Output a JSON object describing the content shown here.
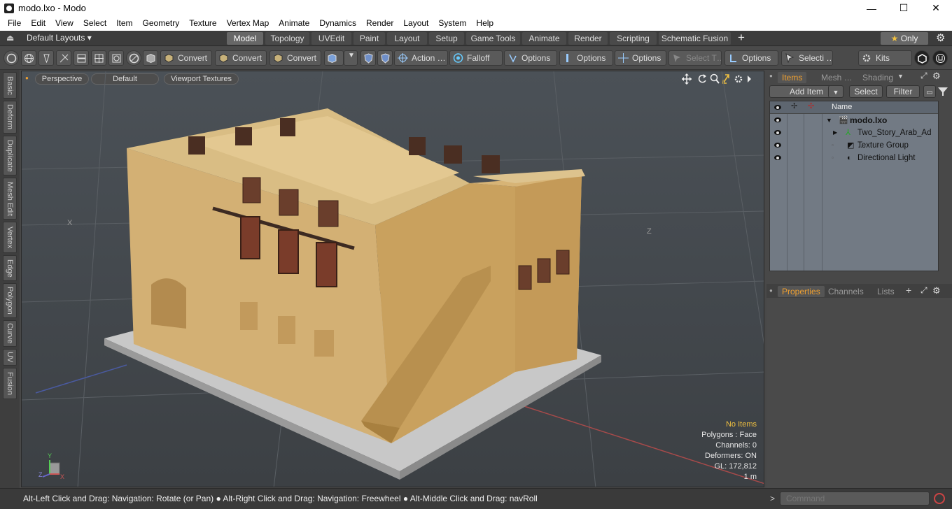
{
  "window": {
    "title": "modo.lxo - Modo",
    "minimize": "—",
    "maximize": "☐",
    "close": "✕"
  },
  "menubar": [
    "File",
    "Edit",
    "View",
    "Select",
    "Item",
    "Geometry",
    "Texture",
    "Vertex Map",
    "Animate",
    "Dynamics",
    "Render",
    "Layout",
    "System",
    "Help"
  ],
  "layoutbar": {
    "layout_selector": "Default Layouts ▾",
    "tabs": [
      "Model",
      "Topology",
      "UVEdit",
      "Paint",
      "Layout",
      "Setup",
      "Game Tools",
      "Animate",
      "Render",
      "Scripting",
      "Schematic Fusion"
    ],
    "active_tab": "Model",
    "add": "+",
    "only": "★  Only",
    "gear": "⚙"
  },
  "toolbar": {
    "convert1": "Convert",
    "convert2": "Convert",
    "convert3": "Convert",
    "action": "Action  …",
    "falloff": "Falloff",
    "options1": "Options",
    "options2": "Options",
    "options3": "Options",
    "select_t": "Select T…",
    "options4": "Options",
    "selecti": "Selecti …",
    "kits": "Kits"
  },
  "lefttabs": [
    "Basic",
    "Deform",
    "Duplicate",
    "Mesh Edit",
    "Vertex",
    "Edge",
    "Polygon",
    "Curve",
    "UV",
    "Fusion"
  ],
  "viewport": {
    "perspective": "Perspective",
    "default": "Default",
    "textures": "Viewport Textures",
    "info": {
      "no_items": "No Items",
      "polygons": "Polygons : Face",
      "channels": "Channels: 0",
      "deformers": "Deformers: ON",
      "gl": "GL: 172,812",
      "scale": "1 m"
    },
    "axis_x": "X",
    "axis_z": "Z",
    "axis_y": "Y"
  },
  "rightpanel": {
    "tabs": [
      "Items",
      "Mesh …",
      "Shading"
    ],
    "add_item": "Add Item",
    "select": "Select",
    "filter": "Filter",
    "name_header": "Name",
    "items": [
      "modo.lxo",
      "Two_Story_Arab_Ad …",
      "Texture Group",
      "Directional Light"
    ],
    "prop_tabs": [
      "Properties",
      "Channels",
      "Lists"
    ],
    "plus": "+"
  },
  "status": {
    "hint": "Alt-Left Click and Drag: Navigation: Rotate (or Pan) ● Alt-Right Click and Drag: Navigation: Freewheel ● Alt-Middle Click and Drag: navRoll",
    "prompt": ">",
    "command_placeholder": "Command"
  },
  "colors": {
    "accent": "#f0a030",
    "viewport_bg": "#464b50",
    "adobe": "#d8b36e"
  }
}
